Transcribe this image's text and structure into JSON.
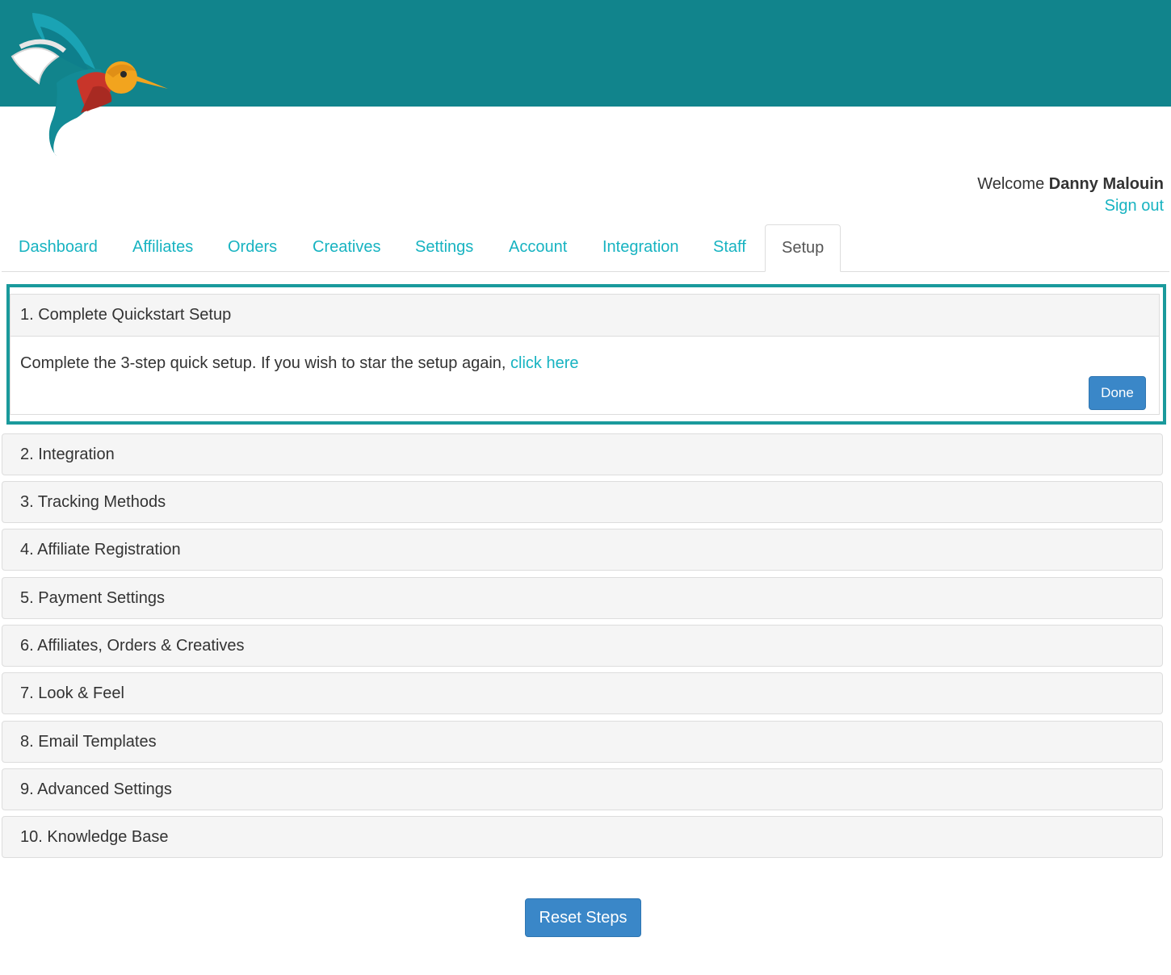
{
  "header": {
    "logo_icon": "hummingbird-logo-icon",
    "brand_color": "#11848c"
  },
  "user": {
    "welcome_prefix": "Welcome",
    "name": "Danny Malouin",
    "sign_out": "Sign out"
  },
  "nav": {
    "tabs": [
      {
        "label": "Dashboard"
      },
      {
        "label": "Affiliates"
      },
      {
        "label": "Orders"
      },
      {
        "label": "Creatives"
      },
      {
        "label": "Settings"
      },
      {
        "label": "Account"
      },
      {
        "label": "Integration"
      },
      {
        "label": "Staff"
      },
      {
        "label": "Setup",
        "active": true
      }
    ]
  },
  "steps": {
    "open": {
      "title": "1. Complete Quickstart Setup",
      "body_text": "Complete the 3-step quick setup. If you wish to star the setup again,",
      "link_text": "click here",
      "done_label": "Done"
    },
    "collapsed": [
      {
        "title": "2. Integration"
      },
      {
        "title": "3. Tracking Methods"
      },
      {
        "title": "4. Affiliate Registration"
      },
      {
        "title": "5. Payment Settings"
      },
      {
        "title": "6. Affiliates, Orders & Creatives"
      },
      {
        "title": "7. Look & Feel"
      },
      {
        "title": "8. Email Templates"
      },
      {
        "title": "9. Advanced Settings"
      },
      {
        "title": "10. Knowledge Base"
      }
    ]
  },
  "footer": {
    "reset_label": "Reset Steps"
  }
}
